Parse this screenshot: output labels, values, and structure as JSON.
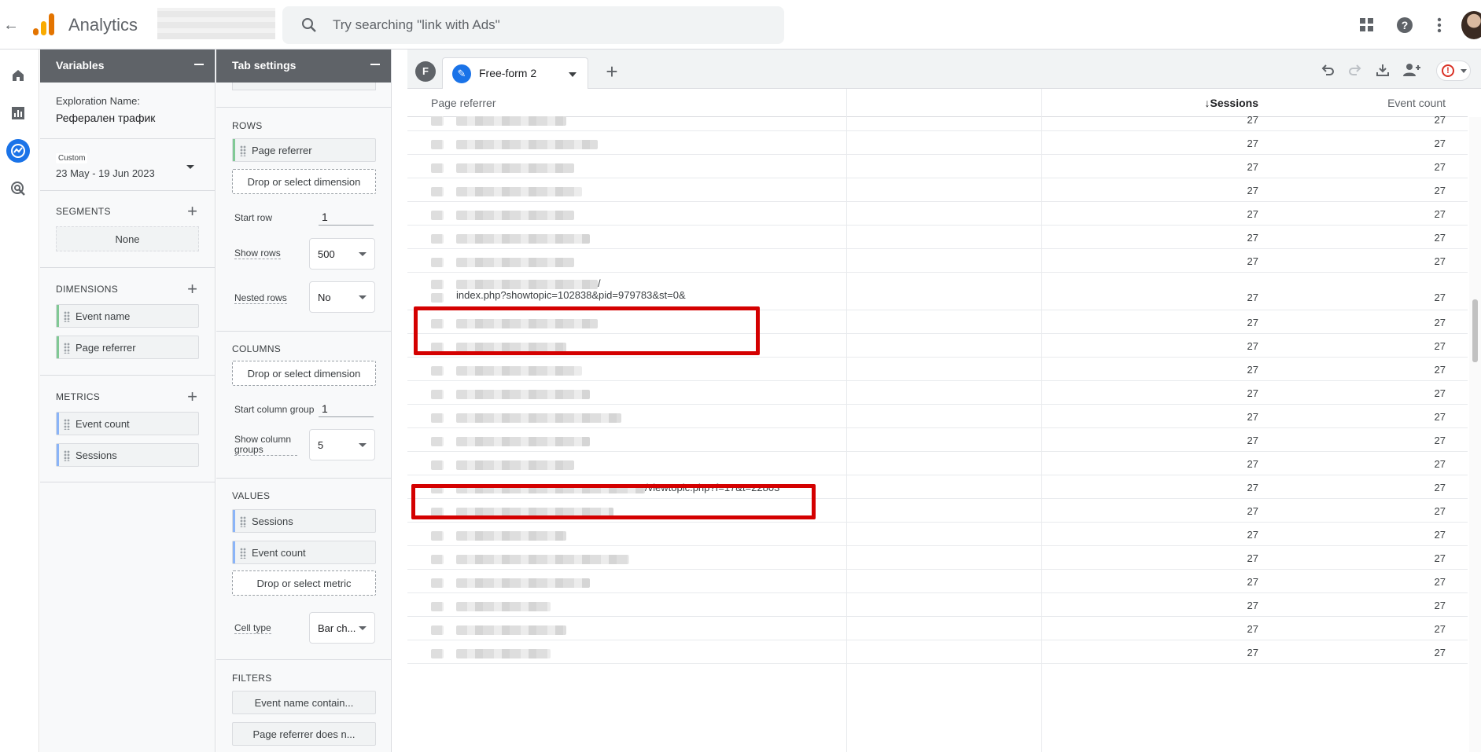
{
  "app": {
    "title": "Analytics",
    "search_placeholder": "Try searching \"link with Ads\""
  },
  "variables": {
    "header": "Variables",
    "exploration_name_label": "Exploration Name:",
    "exploration_name": "Реферален трафик",
    "date_chip": "Custom",
    "date_range": "23 May - 19 Jun 2023",
    "segments_label": "SEGMENTS",
    "segments_none": "None",
    "dimensions_label": "DIMENSIONS",
    "dimensions": [
      "Event name",
      "Page referrer"
    ],
    "metrics_label": "METRICS",
    "metrics": [
      "Event count",
      "Sessions"
    ]
  },
  "tab_settings": {
    "header": "Tab settings",
    "rows_label": "ROWS",
    "row_dimension": "Page referrer",
    "drop_dimension": "Drop or select dimension",
    "start_row_label": "Start row",
    "start_row": "1",
    "show_rows_label": "Show rows",
    "show_rows": "500",
    "nested_rows_label": "Nested rows",
    "nested_rows": "No",
    "columns_label": "COLUMNS",
    "start_column_group_label": "Start column group",
    "start_column_group": "1",
    "show_column_groups_label": "Show column groups",
    "show_column_groups": "5",
    "values_label": "VALUES",
    "values": [
      "Sessions",
      "Event count"
    ],
    "drop_metric": "Drop or select metric",
    "cell_type_label": "Cell type",
    "cell_type": "Bar ch...",
    "filters_label": "FILTERS",
    "filters": [
      "Event name contain...",
      "Page referrer does n..."
    ]
  },
  "canvas": {
    "badge": "F",
    "tab_label": "Free-form 2",
    "table": {
      "columns": [
        "Page referrer",
        "Sessions",
        "Event count"
      ],
      "sort_arrow": "↓",
      "rows": [
        {
          "ref": "",
          "sessions": "27",
          "events": "27"
        },
        {
          "ref": "",
          "sessions": "27",
          "events": "27"
        },
        {
          "ref": "",
          "sessions": "27",
          "events": "27"
        },
        {
          "ref": "",
          "sessions": "27",
          "events": "27"
        },
        {
          "ref": "",
          "sessions": "27",
          "events": "27"
        },
        {
          "ref": "",
          "sessions": "27",
          "events": "27"
        },
        {
          "ref": "",
          "sessions": "27",
          "events": "27"
        },
        {
          "ref": "/",
          "ref2": "index.php?showtopic=102838&pid=979783&st=0&",
          "sessions": "27",
          "events": "27"
        },
        {
          "ref": "",
          "sessions": "27",
          "events": "27"
        },
        {
          "ref": "",
          "sessions": "27",
          "events": "27"
        },
        {
          "ref": "",
          "sessions": "27",
          "events": "27"
        },
        {
          "ref": "",
          "sessions": "27",
          "events": "27"
        },
        {
          "ref": "",
          "sessions": "27",
          "events": "27"
        },
        {
          "ref": "",
          "sessions": "27",
          "events": "27"
        },
        {
          "ref": "",
          "sessions": "27",
          "events": "27"
        },
        {
          "ref": "/viewtopic.php?f=17&t=22803",
          "sessions": "27",
          "events": "27"
        },
        {
          "ref": "",
          "sessions": "27",
          "events": "27"
        },
        {
          "ref": "",
          "sessions": "27",
          "events": "27"
        },
        {
          "ref": "",
          "sessions": "27",
          "events": "27"
        },
        {
          "ref": "",
          "sessions": "27",
          "events": "27"
        },
        {
          "ref": "",
          "sessions": "27",
          "events": "27"
        },
        {
          "ref": "",
          "sessions": "27",
          "events": "27"
        },
        {
          "ref": "",
          "sessions": "27",
          "events": "27"
        }
      ]
    }
  },
  "colors": {
    "accent": "#1a73e8",
    "highlight": "#d40000",
    "dim_bar": "#81c995",
    "metric_bar": "#8ab4f8"
  }
}
